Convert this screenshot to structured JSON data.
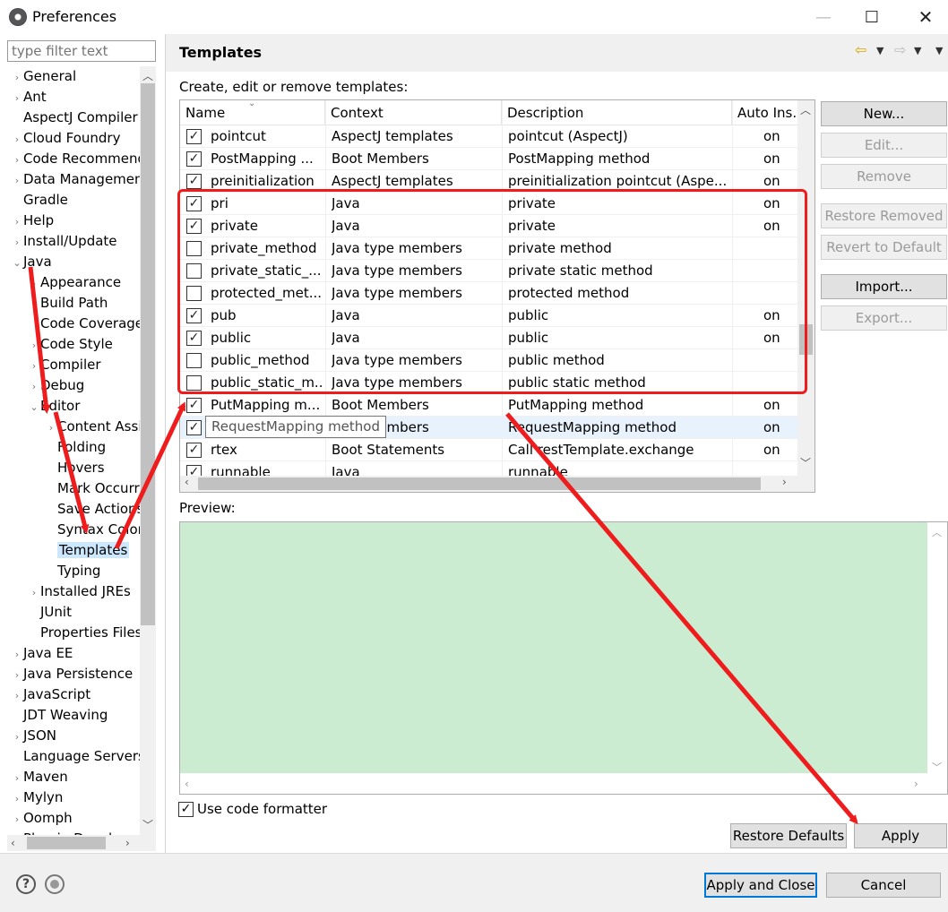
{
  "window": {
    "title": "Preferences",
    "min": "—",
    "max": "☐",
    "close": "✕"
  },
  "filter": {
    "placeholder": "type filter text"
  },
  "tree": [
    {
      "label": "General",
      "twisty": "›",
      "indent": 0
    },
    {
      "label": "Ant",
      "twisty": "›",
      "indent": 0
    },
    {
      "label": "AspectJ Compiler",
      "twisty": "",
      "indent": 0
    },
    {
      "label": "Cloud Foundry",
      "twisty": "›",
      "indent": 0
    },
    {
      "label": "Code Recommenders",
      "twisty": "›",
      "indent": 0
    },
    {
      "label": "Data Management",
      "twisty": "›",
      "indent": 0
    },
    {
      "label": "Gradle",
      "twisty": "",
      "indent": 0
    },
    {
      "label": "Help",
      "twisty": "›",
      "indent": 0
    },
    {
      "label": "Install/Update",
      "twisty": "›",
      "indent": 0
    },
    {
      "label": "Java",
      "twisty": "⌄",
      "indent": 0
    },
    {
      "label": "Appearance",
      "twisty": "›",
      "indent": 1
    },
    {
      "label": "Build Path",
      "twisty": "",
      "indent": 1
    },
    {
      "label": "Code Coverage",
      "twisty": "",
      "indent": 1
    },
    {
      "label": "Code Style",
      "twisty": "›",
      "indent": 1
    },
    {
      "label": "Compiler",
      "twisty": "›",
      "indent": 1
    },
    {
      "label": "Debug",
      "twisty": "›",
      "indent": 1
    },
    {
      "label": "Editor",
      "twisty": "⌄",
      "indent": 1
    },
    {
      "label": "Content Assist",
      "twisty": "›",
      "indent": 2
    },
    {
      "label": "Folding",
      "twisty": "",
      "indent": 2
    },
    {
      "label": "Hovers",
      "twisty": "",
      "indent": 2
    },
    {
      "label": "Mark Occurrences",
      "twisty": "",
      "indent": 2
    },
    {
      "label": "Save Actions",
      "twisty": "",
      "indent": 2
    },
    {
      "label": "Syntax Coloring",
      "twisty": "",
      "indent": 2
    },
    {
      "label": "Templates",
      "twisty": "",
      "indent": 2,
      "selected": true
    },
    {
      "label": "Typing",
      "twisty": "",
      "indent": 2
    },
    {
      "label": "Installed JREs",
      "twisty": "›",
      "indent": 1
    },
    {
      "label": "JUnit",
      "twisty": "",
      "indent": 1
    },
    {
      "label": "Properties Files Editor",
      "twisty": "",
      "indent": 1
    },
    {
      "label": "Java EE",
      "twisty": "›",
      "indent": 0
    },
    {
      "label": "Java Persistence",
      "twisty": "›",
      "indent": 0
    },
    {
      "label": "JavaScript",
      "twisty": "›",
      "indent": 0
    },
    {
      "label": "JDT Weaving",
      "twisty": "",
      "indent": 0
    },
    {
      "label": "JSON",
      "twisty": "›",
      "indent": 0
    },
    {
      "label": "Language Servers",
      "twisty": "",
      "indent": 0
    },
    {
      "label": "Maven",
      "twisty": "›",
      "indent": 0
    },
    {
      "label": "Mylyn",
      "twisty": "›",
      "indent": 0
    },
    {
      "label": "Oomph",
      "twisty": "›",
      "indent": 0
    },
    {
      "label": "Plug-in Development",
      "twisty": "›",
      "indent": 0
    }
  ],
  "page": {
    "title": "Templates",
    "description": "Create, edit or remove templates:",
    "nav_back": "⇦",
    "nav_fwd": "⇨",
    "dd": "▼"
  },
  "table": {
    "columns": [
      "Name",
      "Context",
      "Description",
      "Auto Ins."
    ],
    "rows": [
      {
        "checked": true,
        "name": "pointcut",
        "context": "AspectJ templates",
        "description": "pointcut (AspectJ)",
        "auto": "on"
      },
      {
        "checked": true,
        "name": "PostMapping ...",
        "context": "Boot Members",
        "description": "PostMapping method",
        "auto": "on"
      },
      {
        "checked": true,
        "name": "preinitialization",
        "context": "AspectJ templates",
        "description": "preinitialization pointcut (Aspe...",
        "auto": "on"
      },
      {
        "checked": true,
        "name": "pri",
        "context": "Java",
        "description": "private",
        "auto": "on"
      },
      {
        "checked": true,
        "name": "private",
        "context": "Java",
        "description": "private",
        "auto": "on"
      },
      {
        "checked": false,
        "name": "private_method",
        "context": "Java type members",
        "description": "private method",
        "auto": ""
      },
      {
        "checked": false,
        "name": "private_static_...",
        "context": "Java type members",
        "description": "private static method",
        "auto": ""
      },
      {
        "checked": false,
        "name": "protected_met...",
        "context": "Java type members",
        "description": "protected method",
        "auto": ""
      },
      {
        "checked": true,
        "name": "pub",
        "context": "Java",
        "description": "public",
        "auto": "on"
      },
      {
        "checked": true,
        "name": "public",
        "context": "Java",
        "description": "public",
        "auto": "on"
      },
      {
        "checked": false,
        "name": "public_method",
        "context": "Java type members",
        "description": "public method",
        "auto": ""
      },
      {
        "checked": false,
        "name": "public_static_m...",
        "context": "Java type members",
        "description": "public static method",
        "auto": ""
      },
      {
        "checked": true,
        "name": "PutMapping m...",
        "context": "Boot Members",
        "description": "PutMapping method",
        "auto": "on"
      },
      {
        "checked": true,
        "name": "RequestMapping...",
        "context": "Boot Members",
        "description": "RequestMapping method",
        "auto": "on"
      },
      {
        "checked": true,
        "name": "rtex",
        "context": "Boot Statements",
        "description": "Call restTemplate.exchange",
        "auto": "on"
      },
      {
        "checked": true,
        "name": "runnable",
        "context": "Java",
        "description": "runnable",
        "auto": ""
      }
    ],
    "tooltip": "RequestMapping method"
  },
  "side_buttons": {
    "new": "New...",
    "edit": "Edit...",
    "remove": "Remove",
    "restore_removed": "Restore Removed",
    "revert": "Revert to Default",
    "import": "Import...",
    "export": "Export..."
  },
  "preview": {
    "label": "Preview:"
  },
  "formatter": {
    "label": "Use code formatter",
    "checked": true
  },
  "bottom_buttons": {
    "restore_defaults": "Restore Defaults",
    "apply": "Apply",
    "apply_close": "Apply and Close",
    "cancel": "Cancel"
  },
  "help": {
    "glyph": "?"
  },
  "colors": {
    "annotation": "#ee1c1c",
    "preview_bg": "#cbecd0",
    "selection": "#cce8ff",
    "accent": "#0078d7"
  }
}
